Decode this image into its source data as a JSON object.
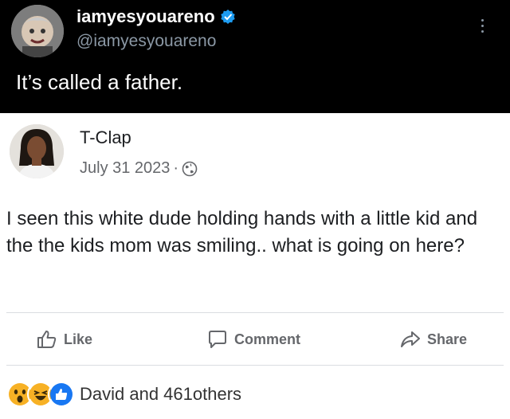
{
  "tweet": {
    "display_name": "iamyesyouareno",
    "handle": "@iamyesyouareno",
    "text": "It’s called a father.",
    "avatar_icon": "cartoon-avatar",
    "verified_icon": "verified-badge-icon",
    "menu_icon": "more-vertical-icon"
  },
  "post": {
    "author": "T-Clap",
    "date": "July 31 2023",
    "date_separator": "·",
    "privacy_icon": "globe-icon",
    "body": "I seen this white dude holding hands with a little kid and the the kids mom was smiling.. what is going on here?"
  },
  "actions": {
    "like_label": "Like",
    "comment_label": "Comment",
    "share_label": "Share"
  },
  "reactions": {
    "icons": [
      "wow-reaction-icon",
      "haha-reaction-icon",
      "like-reaction-icon"
    ],
    "summary": "David and 461others"
  },
  "colors": {
    "tweet_background": "#000000",
    "verified_blue": "#1d9bf0",
    "facebook_blue": "#1877f2",
    "reaction_yellow": "#f7b125"
  }
}
